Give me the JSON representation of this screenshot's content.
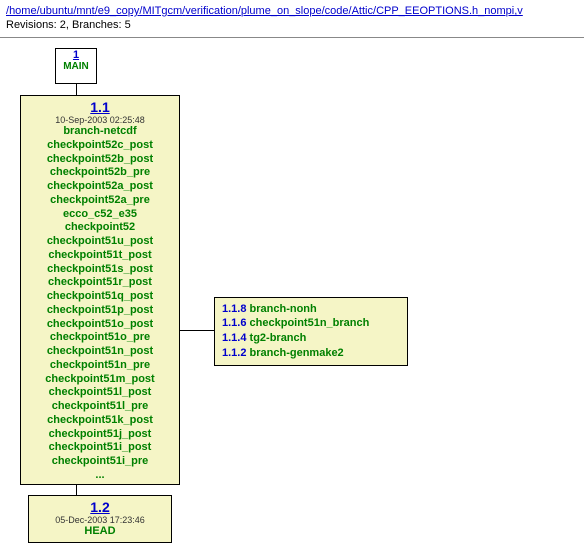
{
  "header": {
    "path_parts": [
      "/",
      "home",
      "/",
      "ubuntu",
      "/",
      "mnt",
      "/",
      "e9_copy",
      "/",
      "MITgcm",
      "/",
      "verification",
      "/",
      "plume_on_slope",
      "/",
      "code",
      "/",
      "Attic",
      "/",
      "CPP_EEOPTIONS.h_nompi,v"
    ],
    "stats": "Revisions: 2, Branches: 5"
  },
  "main_box": {
    "num": "1",
    "label": "MAIN"
  },
  "rev11": {
    "num": "1.1",
    "date": "10-Sep-2003 02:25:48",
    "tags": [
      "branch-netcdf",
      "checkpoint52c_post",
      "checkpoint52b_post",
      "checkpoint52b_pre",
      "checkpoint52a_post",
      "checkpoint52a_pre",
      "ecco_c52_e35",
      "checkpoint52",
      "checkpoint51u_post",
      "checkpoint51t_post",
      "checkpoint51s_post",
      "checkpoint51r_post",
      "checkpoint51q_post",
      "checkpoint51p_post",
      "checkpoint51o_post",
      "checkpoint51o_pre",
      "checkpoint51n_post",
      "checkpoint51n_pre",
      "checkpoint51m_post",
      "checkpoint51l_post",
      "checkpoint51l_pre",
      "checkpoint51k_post",
      "checkpoint51j_post",
      "checkpoint51i_post",
      "checkpoint51i_pre"
    ],
    "more": "..."
  },
  "rev12": {
    "num": "1.2",
    "date": "05-Dec-2003 17:23:46",
    "tag": "HEAD"
  },
  "branch_box": {
    "rows": [
      {
        "num": "1.1.8",
        "name": "branch-nonh"
      },
      {
        "num": "1.1.6",
        "name": "checkpoint51n_branch"
      },
      {
        "num": "1.1.4",
        "name": "tg2-branch"
      },
      {
        "num": "1.1.2",
        "name": "branch-genmake2"
      }
    ]
  }
}
